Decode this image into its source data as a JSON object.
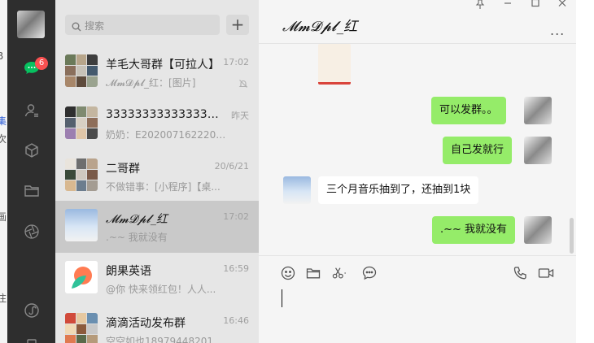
{
  "desktop_edge": {
    "labels": [
      "B",
      "集",
      "次",
      "画",
      "注"
    ]
  },
  "rail": {
    "unread_badge": "6",
    "icons": [
      "chat-icon",
      "contacts-icon",
      "favorites-cube-icon",
      "files-folder-icon",
      "moments-icon",
      "mini-program-icon"
    ]
  },
  "search": {
    "placeholder": "搜索",
    "add_label": "+"
  },
  "conversations": [
    {
      "name": "羊毛大哥群【可拉人】",
      "time": "17:02",
      "preview": "𝓜𝓶𝓓𝓹𝓵_红：[图片]",
      "muted": true
    },
    {
      "name": "33333333333333333...",
      "time": "昨天",
      "preview": "奶奶：E2020071622202..."
    },
    {
      "name": "二哥群",
      "time": "20/6/21",
      "preview": "不做错事：[小程序]【桌..."
    },
    {
      "name": "𝓜𝓶𝓓𝓹𝓵_红",
      "time": "17:02",
      "preview": ".~~ 我就没有"
    },
    {
      "name": "朗果英语",
      "time": "16:59",
      "preview": "@你 快来领红包！人人..."
    },
    {
      "name": "滴滴活动发布群",
      "time": "16:46",
      "preview": "空空如也18979448201"
    }
  ],
  "chat": {
    "title": "𝓜𝓶𝓓𝓹𝓵_红",
    "more": "...",
    "messages": [
      {
        "dir": "out",
        "text": "可以发群。。"
      },
      {
        "dir": "out",
        "text": "自己发就行"
      },
      {
        "dir": "in",
        "text": "三个月音乐抽到了，还抽到1块"
      },
      {
        "dir": "out",
        "text": ".~~ 我就没有"
      }
    ]
  },
  "window_controls": [
    "pin-icon",
    "minimize-icon",
    "maximize-icon",
    "close-icon"
  ],
  "colors": {
    "rail": "#2e2e2e",
    "list_bg": "#e6e6e6",
    "active_row": "#c9c9c9",
    "bubble_out": "#95ec69",
    "badge": "#fa5151"
  }
}
